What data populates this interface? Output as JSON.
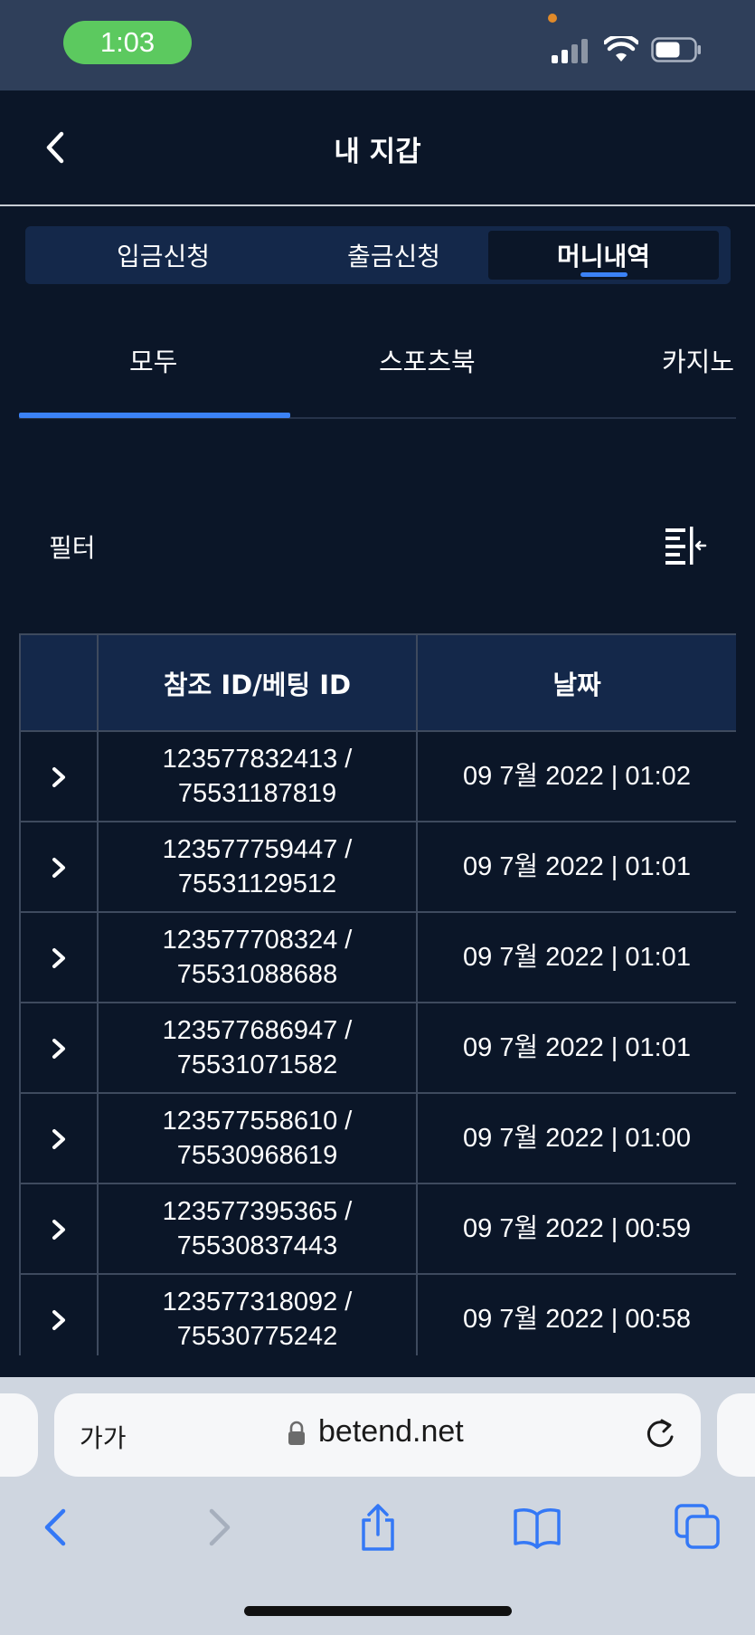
{
  "status_bar": {
    "time": "1:03"
  },
  "header": {
    "title": "내 지갑"
  },
  "segment_tabs": [
    {
      "label": "입금신청",
      "active": false
    },
    {
      "label": "출금신청",
      "active": false
    },
    {
      "label": "머니내역",
      "active": true
    }
  ],
  "category_tabs": [
    {
      "label": "모두",
      "active": true
    },
    {
      "label": "스포츠북",
      "active": false
    },
    {
      "label": "카지노",
      "active": false
    }
  ],
  "filter": {
    "label": "필터"
  },
  "table": {
    "headers": [
      "",
      "참조 ID/베팅 ID",
      "날짜"
    ],
    "rows": [
      {
        "ref_id": "123577832413 /",
        "bet_id": "75531187819",
        "date": "09 7월 2022 | 01:02"
      },
      {
        "ref_id": "123577759447 /",
        "bet_id": "75531129512",
        "date": "09 7월 2022 | 01:01"
      },
      {
        "ref_id": "123577708324 /",
        "bet_id": "75531088688",
        "date": "09 7월 2022 | 01:01"
      },
      {
        "ref_id": "123577686947 /",
        "bet_id": "75531071582",
        "date": "09 7월 2022 | 01:01"
      },
      {
        "ref_id": "123577558610 /",
        "bet_id": "75530968619",
        "date": "09 7월 2022 | 01:00"
      },
      {
        "ref_id": "123577395365 /",
        "bet_id": "75530837443",
        "date": "09 7월 2022 | 00:59"
      },
      {
        "ref_id": "123577318092 /",
        "bet_id": "75530775242",
        "date": "09 7월 2022 | 00:58"
      }
    ]
  },
  "browser": {
    "text_size_label": "가가",
    "url": "betend.net"
  },
  "colors": {
    "background": "#0b1628",
    "accent": "#3b82f6",
    "panel": "#14284a",
    "status_bar": "#2f3f5a"
  }
}
